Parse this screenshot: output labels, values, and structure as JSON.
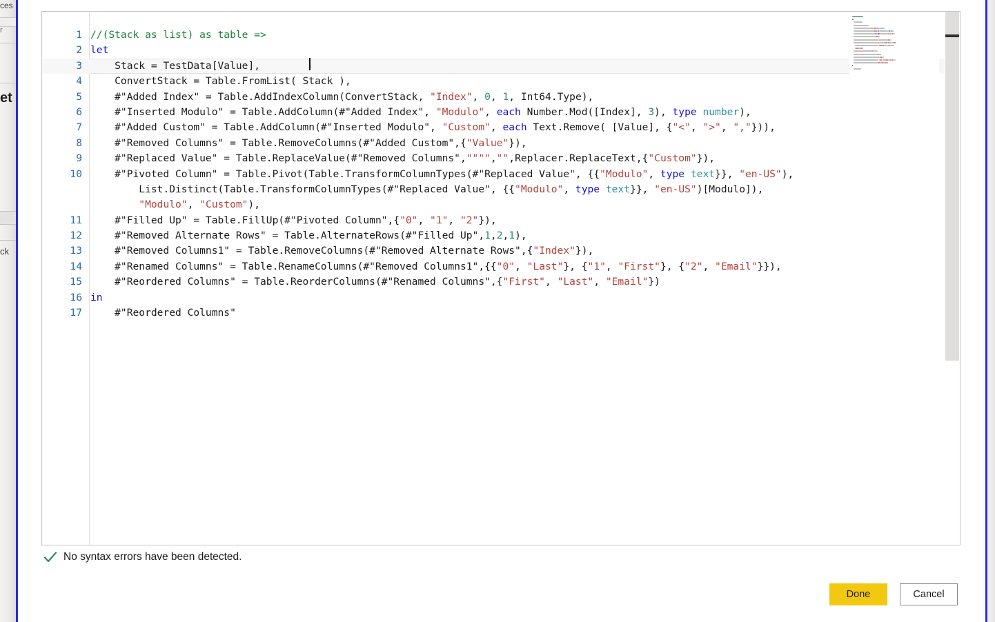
{
  "background_app": {
    "fragments": [
      {
        "text": "ces"
      },
      {
        "text": "r"
      },
      {
        "text": "et"
      },
      {
        "text": "ck"
      }
    ]
  },
  "editor": {
    "name": "advanced-query-editor",
    "language": "M",
    "lines": [
      {
        "number": "1",
        "current": false,
        "tokens": [
          {
            "t": "//(Stack as list) as table =>",
            "c": "t-comment"
          }
        ]
      },
      {
        "number": "2",
        "current": false,
        "tokens": [
          {
            "t": "let",
            "c": "t-keyword"
          }
        ]
      },
      {
        "number": "3",
        "current": true,
        "tokens": [
          {
            "t": "    Stack = TestData[Value],",
            "c": "t-plain"
          }
        ]
      },
      {
        "number": "4",
        "current": false,
        "tokens": [
          {
            "t": "    ConvertStack = Table.FromList( Stack ),",
            "c": "t-plain"
          }
        ]
      },
      {
        "number": "5",
        "current": false,
        "tokens": [
          {
            "t": "    #\"Added Index\" = Table.AddIndexColumn(ConvertStack, ",
            "c": "t-plain"
          },
          {
            "t": "\"Index\"",
            "c": "t-string"
          },
          {
            "t": ", ",
            "c": "t-plain"
          },
          {
            "t": "0",
            "c": "t-number"
          },
          {
            "t": ", ",
            "c": "t-plain"
          },
          {
            "t": "1",
            "c": "t-number"
          },
          {
            "t": ", Int64.Type),",
            "c": "t-plain"
          }
        ]
      },
      {
        "number": "6",
        "current": false,
        "tokens": [
          {
            "t": "    #\"Inserted Modulo\" = Table.AddColumn(#\"Added Index\", ",
            "c": "t-plain"
          },
          {
            "t": "\"Modulo\"",
            "c": "t-string"
          },
          {
            "t": ", ",
            "c": "t-plain"
          },
          {
            "t": "each",
            "c": "t-keyword"
          },
          {
            "t": " Number.Mod([Index], ",
            "c": "t-plain"
          },
          {
            "t": "3",
            "c": "t-number"
          },
          {
            "t": "), ",
            "c": "t-plain"
          },
          {
            "t": "type",
            "c": "t-keyword"
          },
          {
            "t": " ",
            "c": "t-plain"
          },
          {
            "t": "number",
            "c": "t-type"
          },
          {
            "t": "),",
            "c": "t-plain"
          }
        ]
      },
      {
        "number": "7",
        "current": false,
        "tokens": [
          {
            "t": "    #\"Added Custom\" = Table.AddColumn(#\"Inserted Modulo\", ",
            "c": "t-plain"
          },
          {
            "t": "\"Custom\"",
            "c": "t-string"
          },
          {
            "t": ", ",
            "c": "t-plain"
          },
          {
            "t": "each",
            "c": "t-keyword"
          },
          {
            "t": " Text.Remove( [Value], {",
            "c": "t-plain"
          },
          {
            "t": "\"<\"",
            "c": "t-string"
          },
          {
            "t": ", ",
            "c": "t-plain"
          },
          {
            "t": "\">\"",
            "c": "t-string"
          },
          {
            "t": ", ",
            "c": "t-plain"
          },
          {
            "t": "\",\"",
            "c": "t-string"
          },
          {
            "t": "})),",
            "c": "t-plain"
          }
        ]
      },
      {
        "number": "8",
        "current": false,
        "tokens": [
          {
            "t": "    #\"Removed Columns\" = Table.RemoveColumns(#\"Added Custom\",{",
            "c": "t-plain"
          },
          {
            "t": "\"Value\"",
            "c": "t-string"
          },
          {
            "t": "}),",
            "c": "t-plain"
          }
        ]
      },
      {
        "number": "9",
        "current": false,
        "tokens": [
          {
            "t": "    #\"Replaced Value\" = Table.ReplaceValue(#\"Removed Columns\",",
            "c": "t-plain"
          },
          {
            "t": "\"\"\"\"",
            "c": "t-string"
          },
          {
            "t": ",",
            "c": "t-plain"
          },
          {
            "t": "\"\"",
            "c": "t-string"
          },
          {
            "t": ",Replacer.ReplaceText,{",
            "c": "t-plain"
          },
          {
            "t": "\"Custom\"",
            "c": "t-string"
          },
          {
            "t": "}),",
            "c": "t-plain"
          }
        ]
      },
      {
        "number": "10",
        "current": false,
        "tokens": [
          {
            "t": "    #\"Pivoted Column\" = Table.Pivot(Table.TransformColumnTypes(#\"Replaced Value\", {{",
            "c": "t-plain"
          },
          {
            "t": "\"Modulo\"",
            "c": "t-string"
          },
          {
            "t": ", ",
            "c": "t-plain"
          },
          {
            "t": "type",
            "c": "t-keyword"
          },
          {
            "t": " ",
            "c": "t-plain"
          },
          {
            "t": "text",
            "c": "t-type"
          },
          {
            "t": "}}, ",
            "c": "t-plain"
          },
          {
            "t": "\"en-US\"",
            "c": "t-string"
          },
          {
            "t": "),",
            "c": "t-plain"
          }
        ]
      },
      {
        "number": "",
        "current": false,
        "tokens": [
          {
            "t": "        List.Distinct(Table.TransformColumnTypes(#\"Replaced Value\", {{",
            "c": "t-plain"
          },
          {
            "t": "\"Modulo\"",
            "c": "t-string"
          },
          {
            "t": ", ",
            "c": "t-plain"
          },
          {
            "t": "type",
            "c": "t-keyword"
          },
          {
            "t": " ",
            "c": "t-plain"
          },
          {
            "t": "text",
            "c": "t-type"
          },
          {
            "t": "}}, ",
            "c": "t-plain"
          },
          {
            "t": "\"en-US\"",
            "c": "t-string"
          },
          {
            "t": ")[Modulo]),",
            "c": "t-plain"
          }
        ]
      },
      {
        "number": "",
        "current": false,
        "tokens": [
          {
            "t": "        ",
            "c": "t-plain"
          },
          {
            "t": "\"Modulo\"",
            "c": "t-string"
          },
          {
            "t": ", ",
            "c": "t-plain"
          },
          {
            "t": "\"Custom\"",
            "c": "t-string"
          },
          {
            "t": "),",
            "c": "t-plain"
          }
        ]
      },
      {
        "number": "11",
        "current": false,
        "tokens": [
          {
            "t": "    #\"Filled Up\" = Table.FillUp(#\"Pivoted Column\",{",
            "c": "t-plain"
          },
          {
            "t": "\"0\"",
            "c": "t-string"
          },
          {
            "t": ", ",
            "c": "t-plain"
          },
          {
            "t": "\"1\"",
            "c": "t-string"
          },
          {
            "t": ", ",
            "c": "t-plain"
          },
          {
            "t": "\"2\"",
            "c": "t-string"
          },
          {
            "t": "}),",
            "c": "t-plain"
          }
        ]
      },
      {
        "number": "12",
        "current": false,
        "tokens": [
          {
            "t": "    #\"Removed Alternate Rows\" = Table.AlternateRows(#\"Filled Up\",",
            "c": "t-plain"
          },
          {
            "t": "1",
            "c": "t-number"
          },
          {
            "t": ",",
            "c": "t-plain"
          },
          {
            "t": "2",
            "c": "t-number"
          },
          {
            "t": ",",
            "c": "t-plain"
          },
          {
            "t": "1",
            "c": "t-number"
          },
          {
            "t": "),",
            "c": "t-plain"
          }
        ]
      },
      {
        "number": "13",
        "current": false,
        "tokens": [
          {
            "t": "    #\"Removed Columns1\" = Table.RemoveColumns(#\"Removed Alternate Rows\",{",
            "c": "t-plain"
          },
          {
            "t": "\"Index\"",
            "c": "t-string"
          },
          {
            "t": "}),",
            "c": "t-plain"
          }
        ]
      },
      {
        "number": "14",
        "current": false,
        "tokens": [
          {
            "t": "    #\"Renamed Columns\" = Table.RenameColumns(#\"Removed Columns1\",{{",
            "c": "t-plain"
          },
          {
            "t": "\"0\"",
            "c": "t-string"
          },
          {
            "t": ", ",
            "c": "t-plain"
          },
          {
            "t": "\"Last\"",
            "c": "t-string"
          },
          {
            "t": "}, {",
            "c": "t-plain"
          },
          {
            "t": "\"1\"",
            "c": "t-string"
          },
          {
            "t": ", ",
            "c": "t-plain"
          },
          {
            "t": "\"First\"",
            "c": "t-string"
          },
          {
            "t": "}, {",
            "c": "t-plain"
          },
          {
            "t": "\"2\"",
            "c": "t-string"
          },
          {
            "t": ", ",
            "c": "t-plain"
          },
          {
            "t": "\"Email\"",
            "c": "t-string"
          },
          {
            "t": "}}),",
            "c": "t-plain"
          }
        ]
      },
      {
        "number": "15",
        "current": false,
        "tokens": [
          {
            "t": "    #\"Reordered Columns\" = Table.ReorderColumns(#\"Renamed Columns\",{",
            "c": "t-plain"
          },
          {
            "t": "\"First\"",
            "c": "t-string"
          },
          {
            "t": ", ",
            "c": "t-plain"
          },
          {
            "t": "\"Last\"",
            "c": "t-string"
          },
          {
            "t": ", ",
            "c": "t-plain"
          },
          {
            "t": "\"Email\"",
            "c": "t-string"
          },
          {
            "t": "})",
            "c": "t-plain"
          }
        ]
      },
      {
        "number": "16",
        "current": false,
        "tokens": [
          {
            "t": "in",
            "c": "t-keyword"
          }
        ]
      },
      {
        "number": "17",
        "current": false,
        "tokens": [
          {
            "t": "    #\"Reordered Columns\"",
            "c": "t-plain"
          }
        ]
      }
    ]
  },
  "status": {
    "icon": "checkmark-icon",
    "text": "No syntax errors have been detected.",
    "color": "#2e8b57"
  },
  "footer": {
    "done_label": "Done",
    "cancel_label": "Cancel",
    "done_color": "#f2c811"
  },
  "colors": {
    "accent": "#f2c811",
    "comment": "#1a7f37",
    "keyword": "#1414d6",
    "string": "#b5403a",
    "number": "#2a8c6a",
    "type": "#2b8fa8",
    "line_number": "#2b6cb0",
    "frame": "#2b2bdd"
  }
}
